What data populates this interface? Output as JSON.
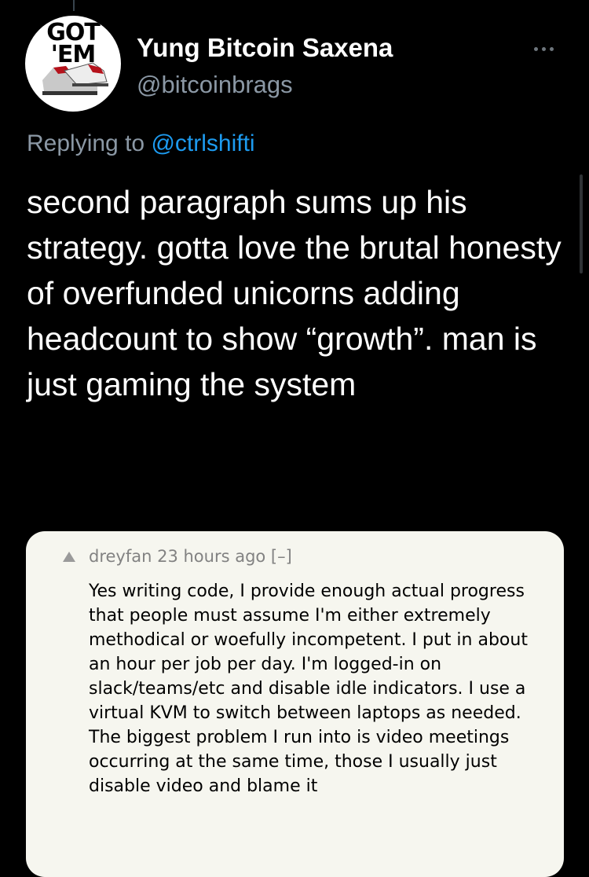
{
  "tweet": {
    "author": {
      "display_name": "Yung Bitcoin Saxena",
      "handle": "@bitcoinbrags",
      "avatar_text": "GOT\n'EM"
    },
    "more_icon": "more-horizontal-icon",
    "reply_prefix": "Replying to",
    "reply_mention": "@ctrlshifti",
    "text": "second paragraph sums up his strategy. gotta love the brutal honesty of overfunded unicorns adding headcount to show “growth”. man is just gaming the system"
  },
  "embedded_comment": {
    "meta": "dreyfan 23 hours ago [–]",
    "text": "Yes writing code, I provide enough actual progress that people must assume I'm either extremely methodical or woefully incompetent. I put in about an hour per job per day. I'm logged-in on slack/teams/etc and disable idle indicators. I use a virtual KVM to switch between laptops as needed. The biggest problem I run into is video meetings occurring at the same time, those I usually just disable video and blame it"
  },
  "colors": {
    "background": "#000000",
    "secondary_text": "#8b98a5",
    "mention": "#1d9bf0",
    "card_background": "#f6f6ef"
  }
}
